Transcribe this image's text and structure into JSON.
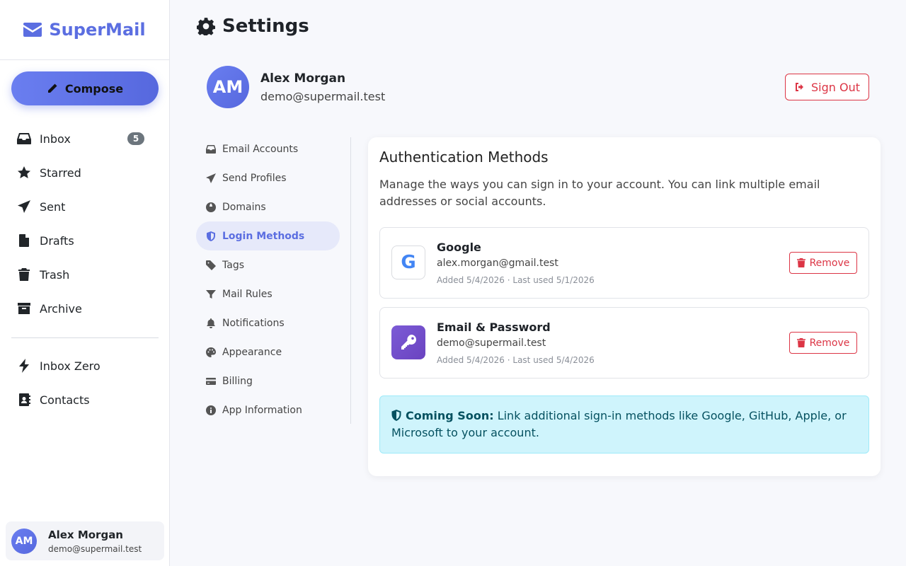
{
  "brand": {
    "name": "SuperMail",
    "color": "#5b6ee1",
    "icon": "envelope-icon"
  },
  "compose": {
    "label": "Compose",
    "icon": "pencil-icon"
  },
  "nav": {
    "items": [
      {
        "label": "Inbox",
        "icon": "inbox-icon",
        "badge": "5"
      },
      {
        "label": "Starred",
        "icon": "star-icon"
      },
      {
        "label": "Sent",
        "icon": "paper-plane-icon"
      },
      {
        "label": "Drafts",
        "icon": "file-icon"
      },
      {
        "label": "Trash",
        "icon": "trash-icon"
      },
      {
        "label": "Archive",
        "icon": "archive-icon"
      }
    ],
    "secondary": [
      {
        "label": "Inbox Zero",
        "icon": "bolt-icon"
      },
      {
        "label": "Contacts",
        "icon": "address-book-icon"
      }
    ]
  },
  "sidebar_user": {
    "initials": "AM",
    "name": "Alex Morgan",
    "email": "demo@supermail.test"
  },
  "page": {
    "title": "Settings",
    "icon": "gear-icon"
  },
  "profile": {
    "initials": "AM",
    "name": "Alex Morgan",
    "email": "demo@supermail.test",
    "sign_out_label": "Sign Out"
  },
  "settings_nav": {
    "active": "Login Methods",
    "items": [
      {
        "label": "Email Accounts",
        "icon": "inbox-icon"
      },
      {
        "label": "Send Profiles",
        "icon": "paper-plane-icon"
      },
      {
        "label": "Domains",
        "icon": "globe-icon"
      },
      {
        "label": "Login Methods",
        "icon": "shield-icon"
      },
      {
        "label": "Tags",
        "icon": "tag-icon"
      },
      {
        "label": "Mail Rules",
        "icon": "filter-icon"
      },
      {
        "label": "Notifications",
        "icon": "bell-icon"
      },
      {
        "label": "Appearance",
        "icon": "palette-icon"
      },
      {
        "label": "Billing",
        "icon": "credit-card-icon"
      },
      {
        "label": "App Information",
        "icon": "info-icon"
      }
    ]
  },
  "auth": {
    "title": "Authentication Methods",
    "description": "Manage the ways you can sign in to your account. You can link multiple email addresses or social accounts.",
    "methods": [
      {
        "name": "Google",
        "email": "alex.morgan@gmail.test",
        "meta": "Added 5/4/2026 · Last used 5/1/2026",
        "logo_letter": "G",
        "remove_label": "Remove"
      },
      {
        "name": "Email & Password",
        "email": "demo@supermail.test",
        "meta": "Added 5/4/2026 · Last used 5/4/2026",
        "remove_label": "Remove"
      }
    ],
    "notice": {
      "title": "Coming Soon:",
      "text": " Link additional sign-in methods like Google, GitHub, Apple, or Microsoft to your account."
    }
  },
  "colors": {
    "accent": "#5b6ee1",
    "danger": "#dc3545",
    "info_bg": "#cff4fc",
    "info_text": "#055160"
  }
}
